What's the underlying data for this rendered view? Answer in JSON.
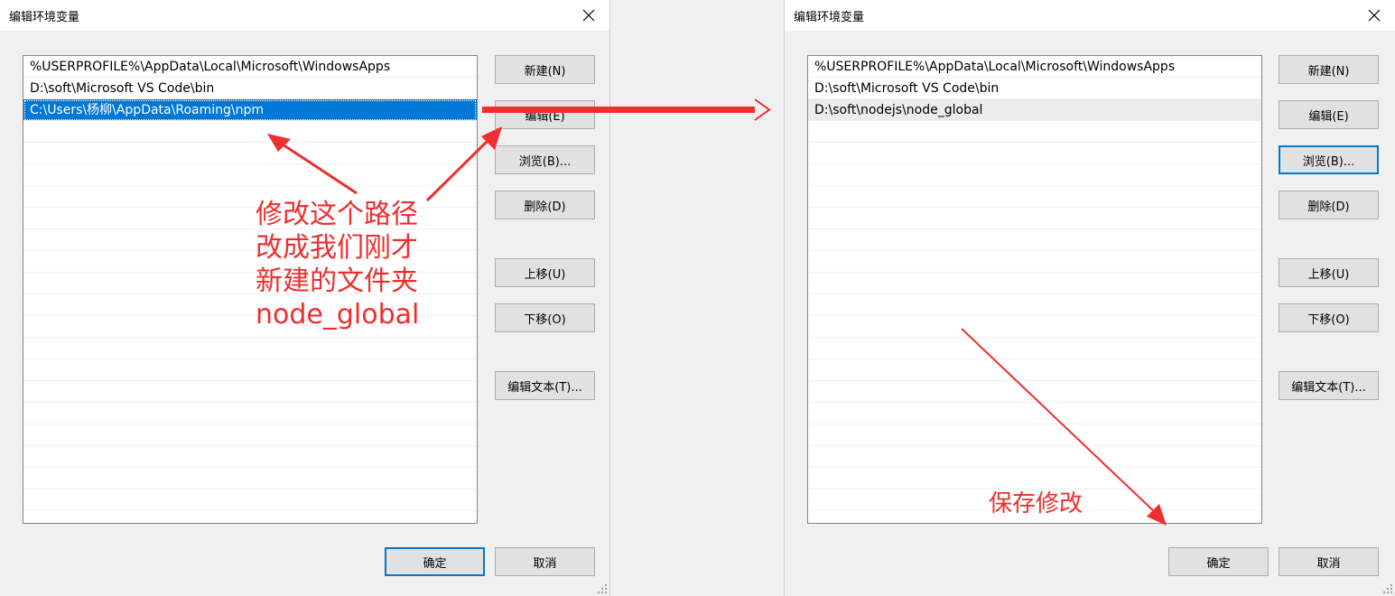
{
  "left_dialog": {
    "title": "编辑环境变量",
    "paths": [
      "%USERPROFILE%\\AppData\\Local\\Microsoft\\WindowsApps",
      "D:\\soft\\Microsoft VS Code\\bin",
      "C:\\Users\\杨柳\\AppData\\Roaming\\npm"
    ],
    "selected_index": 2,
    "buttons": {
      "new": "新建(N)",
      "edit": "编辑(E)",
      "browse": "浏览(B)...",
      "delete": "删除(D)",
      "move_up": "上移(U)",
      "move_down": "下移(O)",
      "edit_text": "编辑文本(T)...",
      "ok": "确定",
      "cancel": "取消"
    }
  },
  "right_dialog": {
    "title": "编辑环境变量",
    "paths": [
      "%USERPROFILE%\\AppData\\Local\\Microsoft\\WindowsApps",
      "D:\\soft\\Microsoft VS Code\\bin",
      "D:\\soft\\nodejs\\node_global"
    ],
    "selected_index": 2,
    "buttons": {
      "new": "新建(N)",
      "edit": "编辑(E)",
      "browse": "浏览(B)...",
      "delete": "删除(D)",
      "move_up": "上移(U)",
      "move_down": "下移(O)",
      "edit_text": "编辑文本(T)...",
      "ok": "确定",
      "cancel": "取消"
    }
  },
  "annotations": {
    "left_note": [
      "修改这个路径",
      "改成我们刚才",
      "新建的文件夹",
      "node_global"
    ],
    "right_note": "保存修改",
    "color": "#ef2e2e"
  },
  "colors": {
    "selection": "#0078d7",
    "dialog_bg": "#f0f0f0",
    "button_bg": "#e1e1e1"
  }
}
